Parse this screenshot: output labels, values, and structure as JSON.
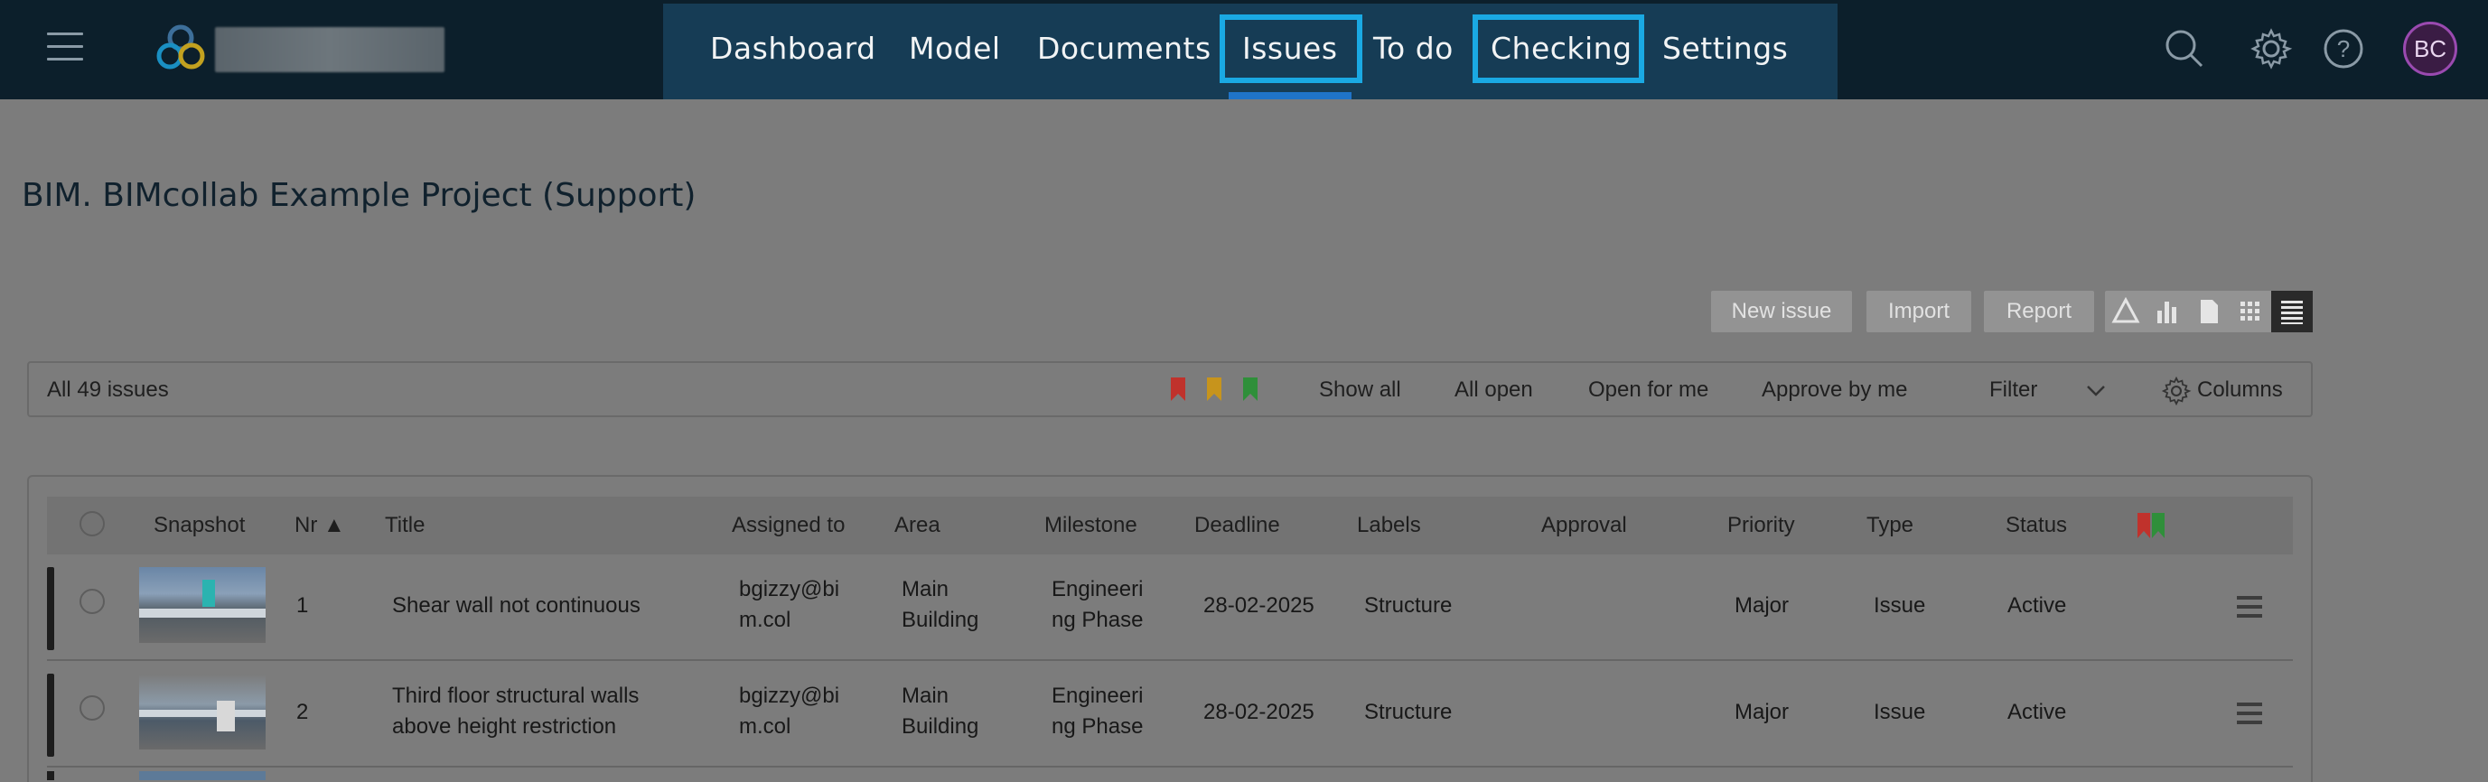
{
  "nav": {
    "items": [
      "Dashboard",
      "Model",
      "Documents",
      "Issues",
      "To do",
      "Checking",
      "Settings"
    ],
    "active": "Issues",
    "highlighted": [
      "Issues",
      "Checking"
    ],
    "icons": [
      "search-icon",
      "gear-icon",
      "help-icon"
    ],
    "avatar_initials": "BC",
    "colors": {
      "bar": "#0c1f2b",
      "panel": "#163c55",
      "highlight": "#1aa9e3",
      "underline": "#1f74c9"
    }
  },
  "project": {
    "title": "BIM. BIMcollab Example Project (Support)"
  },
  "actions": {
    "new_issue": "New issue",
    "import": "Import",
    "report": "Report",
    "views": [
      "bcf-icon",
      "chart-icon",
      "document-icon",
      "grid-icon",
      "list-icon"
    ]
  },
  "filterbar": {
    "count": "All 49 issues",
    "flag_colors": [
      "#c0322c",
      "#c7941c",
      "#2f8f3a"
    ],
    "show_all": "Show all",
    "all_open": "All open",
    "open_for_me": "Open for me",
    "approve_by_me": "Approve by me",
    "filter": "Filter",
    "columns": "Columns"
  },
  "table": {
    "headers": [
      "Snapshot",
      "Nr ▲",
      "Title",
      "Assigned to",
      "Area",
      "Milestone",
      "Deadline",
      "Labels",
      "Approval",
      "Priority",
      "Type",
      "Status"
    ],
    "rows": [
      {
        "nr": "1",
        "title": [
          "Shear wall not continuous",
          ""
        ],
        "assigned": [
          "bgizzy@bi",
          "m.col"
        ],
        "area": [
          "Main",
          "Building"
        ],
        "milestone": [
          "Engineeri",
          "ng Phase"
        ],
        "deadline": "28-02-2025",
        "labels": "Structure",
        "approval": "",
        "priority": "Major",
        "type": "Issue",
        "status": "Active"
      },
      {
        "nr": "2",
        "title": [
          "Third floor structural walls",
          "above height restriction"
        ],
        "assigned": [
          "bgizzy@bi",
          "m.col"
        ],
        "area": [
          "Main",
          "Building"
        ],
        "milestone": [
          "Engineeri",
          "ng Phase"
        ],
        "deadline": "28-02-2025",
        "labels": "Structure",
        "approval": "",
        "priority": "Major",
        "type": "Issue",
        "status": "Active"
      }
    ]
  }
}
